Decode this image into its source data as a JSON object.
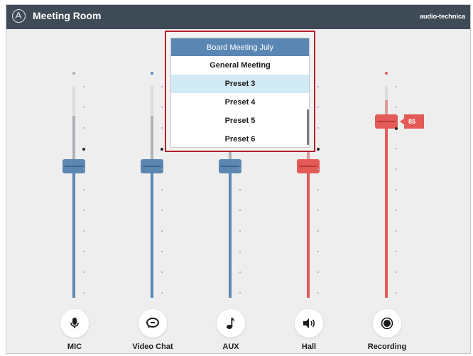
{
  "titlebar": {
    "title": "Meeting Room",
    "brand": "audio-technica",
    "logo_icon": "audio-technica-logo-icon"
  },
  "colors": {
    "titlebar_bg": "#3f4a57",
    "blue_channel": "#5b87b2",
    "red_channel": "#e45a56",
    "gray_peak": "#aeb2b7",
    "dropdown_header": "#5a86b3",
    "dropdown_selected": "#d2e9f6",
    "dropdown_border": "#b41f2c"
  },
  "preset_dropdown": {
    "items": [
      "Board Meeting July",
      "General Meeting",
      "Preset 3",
      "Preset 4",
      "Preset 5",
      "Preset 6"
    ],
    "selected": "Preset 3"
  },
  "channels": [
    {
      "label": "MIC",
      "icon": "microphone-icon",
      "color": "blue",
      "level": 0.58
    },
    {
      "label": "Video Chat",
      "icon": "chat-icon",
      "color": "blue",
      "level": 0.58
    },
    {
      "label": "AUX",
      "icon": "music-note-icon",
      "color": "blue",
      "level": 0.58
    },
    {
      "label": "Hall",
      "icon": "speaker-icon",
      "color": "red",
      "level": 0.58
    },
    {
      "label": "Recording",
      "icon": "record-icon",
      "color": "red",
      "level": 0.85,
      "value": "85"
    }
  ]
}
